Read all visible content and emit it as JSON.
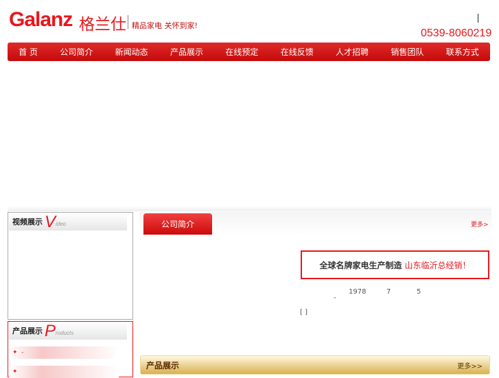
{
  "header": {
    "logo": "Galanz",
    "logo_cn": "格兰仕",
    "slogan": "精品家电 关怀到家!",
    "phone": "0539-8060219"
  },
  "nav": [
    "首 页",
    "公司简介",
    "新闻动态",
    "产品展示",
    "在线预定",
    "在线反馈",
    "人才招聘",
    "销售团队",
    "联系方式"
  ],
  "video": {
    "title": "视频展示",
    "letter": "V",
    "suffix": "ideo"
  },
  "products_box": {
    "title": "产品展示",
    "letter": "P",
    "suffix": "roducts",
    "items": [
      "-",
      ""
    ]
  },
  "about": {
    "tab": "公司简介",
    "more": "更多>",
    "banner_a": "全球名牌家电生产制造",
    "banner_b": "山东临沂总经销！",
    "year": "1978",
    "month": "7",
    "day": "5",
    "quote": "\"",
    "brackets": "[ ]"
  },
  "products_bar": {
    "title": "产品展示",
    "more": "更多>>"
  }
}
